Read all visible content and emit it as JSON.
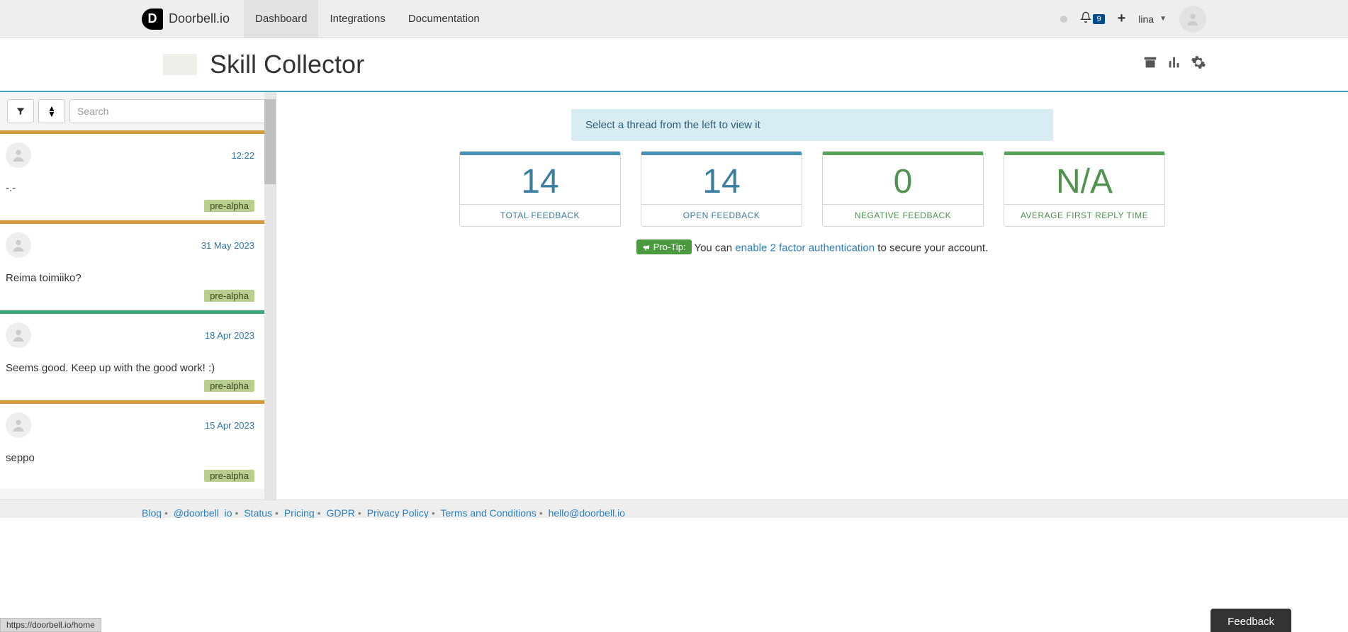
{
  "brand": {
    "name": "Doorbell.io"
  },
  "nav": {
    "dashboard": "Dashboard",
    "integrations": "Integrations",
    "documentation": "Documentation"
  },
  "notifications": {
    "count": "9"
  },
  "user": {
    "name": "lina"
  },
  "app": {
    "title": "Skill Collector"
  },
  "sidebar": {
    "search_placeholder": "Search",
    "threads": [
      {
        "time": "12:22",
        "body": "-.-",
        "tag": "pre-alpha",
        "color": "orange"
      },
      {
        "time": "31 May 2023",
        "body": "Reima toimiiko?",
        "tag": "pre-alpha",
        "color": "orange"
      },
      {
        "time": "18 Apr 2023",
        "body": "Seems good. Keep up with the good work! :)",
        "tag": "pre-alpha",
        "color": "green"
      },
      {
        "time": "15 Apr 2023",
        "body": "seppo",
        "tag": "pre-alpha",
        "color": "orange"
      }
    ]
  },
  "content": {
    "banner": "Select a thread from the left to view it",
    "stats": {
      "total": {
        "value": "14",
        "label": "TOTAL FEEDBACK"
      },
      "open": {
        "value": "14",
        "label": "OPEN FEEDBACK"
      },
      "negative": {
        "value": "0",
        "label": "NEGATIVE FEEDBACK"
      },
      "reply": {
        "value": "N/A",
        "label": "AVERAGE FIRST REPLY TIME"
      }
    },
    "protip": {
      "badge": "Pro-Tip:",
      "before": "You can ",
      "link": "enable 2 factor authentication",
      "after": " to secure your account."
    }
  },
  "footer": {
    "blog": "Blog",
    "twitter": "@doorbell_io",
    "status": "Status",
    "pricing": "Pricing",
    "gdpr": "GDPR",
    "privacy": "Privacy Policy",
    "terms": "Terms and Conditions",
    "email": "hello@doorbell.io"
  },
  "statusbar": {
    "url": "https://doorbell.io/home"
  },
  "feedback_button": "Feedback"
}
